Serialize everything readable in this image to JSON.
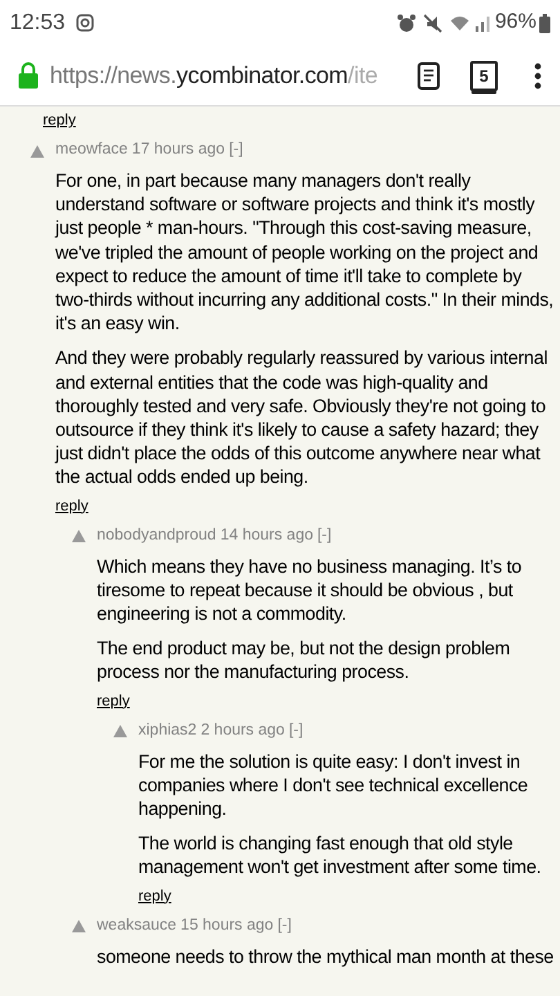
{
  "status_bar": {
    "time": "12:53",
    "battery": "96%"
  },
  "url_bar": {
    "url_prefix": "https://news.",
    "url_domain": "ycombinator.com",
    "url_path": "/ite",
    "tab_count": "5"
  },
  "top_reply": "reply",
  "comments": [
    {
      "user": "meowface",
      "age": "17 hours ago",
      "toggle": "[-]",
      "paragraphs": [
        "For one, in part because many managers don't really understand software or software projects and think it's mostly just people * man-hours. \"Through this cost-saving measure, we've tripled the amount of people working on the project and expect to reduce the amount of time it'll take to complete by two-thirds without incurring any additional costs.\" In their minds, it's an easy win.",
        "And they were probably regularly reassured by various internal and external entities that the code was high-quality and thoroughly tested and very safe. Obviously they're not going to outsource if they think it's likely to cause a safety hazard; they just didn't place the odds of this outcome anywhere near what the actual odds ended up being."
      ],
      "reply": "reply",
      "children": [
        {
          "user": "nobodyandproud",
          "age": "14 hours ago",
          "toggle": "[-]",
          "paragraphs": [
            "Which means they have no business managing. It’s to tiresome to repeat because it should be obvious , but engineering is not a commodity.",
            "The end product may be, but not the design problem process nor the manufacturing process."
          ],
          "reply": "reply",
          "children": [
            {
              "user": "xiphias2",
              "age": "2 hours ago",
              "toggle": "[-]",
              "paragraphs": [
                "For me the solution is quite easy: I don't invest in companies where I don't see technical excellence happening.",
                "The world is changing fast enough that old style management won't get investment after some time."
              ],
              "reply": "reply"
            }
          ]
        },
        {
          "user": "weaksauce",
          "age": "15 hours ago",
          "toggle": "[-]",
          "paragraphs": [
            "someone needs to throw the mythical man month at these"
          ]
        }
      ]
    }
  ]
}
